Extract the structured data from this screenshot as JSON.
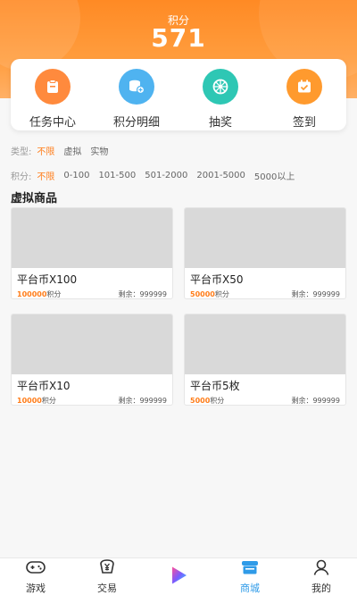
{
  "header": {
    "points_label": "积分",
    "points_value": "571"
  },
  "quick_actions": [
    {
      "label": "任务中心",
      "icon": "task-clipboard-icon",
      "color": "#ff8a3d"
    },
    {
      "label": "积分明细",
      "icon": "coins-stack-icon",
      "color": "#4fb3f0"
    },
    {
      "label": "抽奖",
      "icon": "lottery-wheel-icon",
      "color": "#2ec7b4"
    },
    {
      "label": "签到",
      "icon": "calendar-check-icon",
      "color": "#ff9a2e"
    }
  ],
  "filters": {
    "type": {
      "title": "类型:",
      "options": [
        "不限",
        "虚拟",
        "实物"
      ],
      "selected": "不限"
    },
    "points": {
      "title": "积分:",
      "options": [
        "不限",
        "0-100",
        "101-500",
        "501-2000",
        "2001-5000",
        "5000以上"
      ],
      "selected": "不限"
    }
  },
  "section_title": "虚拟商品",
  "products": [
    {
      "name": "平台币X100",
      "price": "100000",
      "price_unit": "积分",
      "stock": "剩余：999999"
    },
    {
      "name": "平台币X50",
      "price": "50000",
      "price_unit": "积分",
      "stock": "剩余：999999"
    },
    {
      "name": "平台币X10",
      "price": "10000",
      "price_unit": "积分",
      "stock": "剩余：999999"
    },
    {
      "name": "平台币5枚",
      "price": "5000",
      "price_unit": "积分",
      "stock": "剩余：999999"
    }
  ],
  "tabbar": [
    {
      "label": "游戏",
      "icon": "gamepad-icon",
      "active": false
    },
    {
      "label": "交易",
      "icon": "trade-yen-icon",
      "active": false
    },
    {
      "label": "",
      "icon": "play-logo-icon",
      "active": false
    },
    {
      "label": "商城",
      "icon": "store-icon",
      "active": true
    },
    {
      "label": "我的",
      "icon": "user-icon",
      "active": false
    }
  ],
  "colors": {
    "accent": "#ff7d1a",
    "header": "#ff8a24",
    "tab_active": "#2f9be8"
  }
}
